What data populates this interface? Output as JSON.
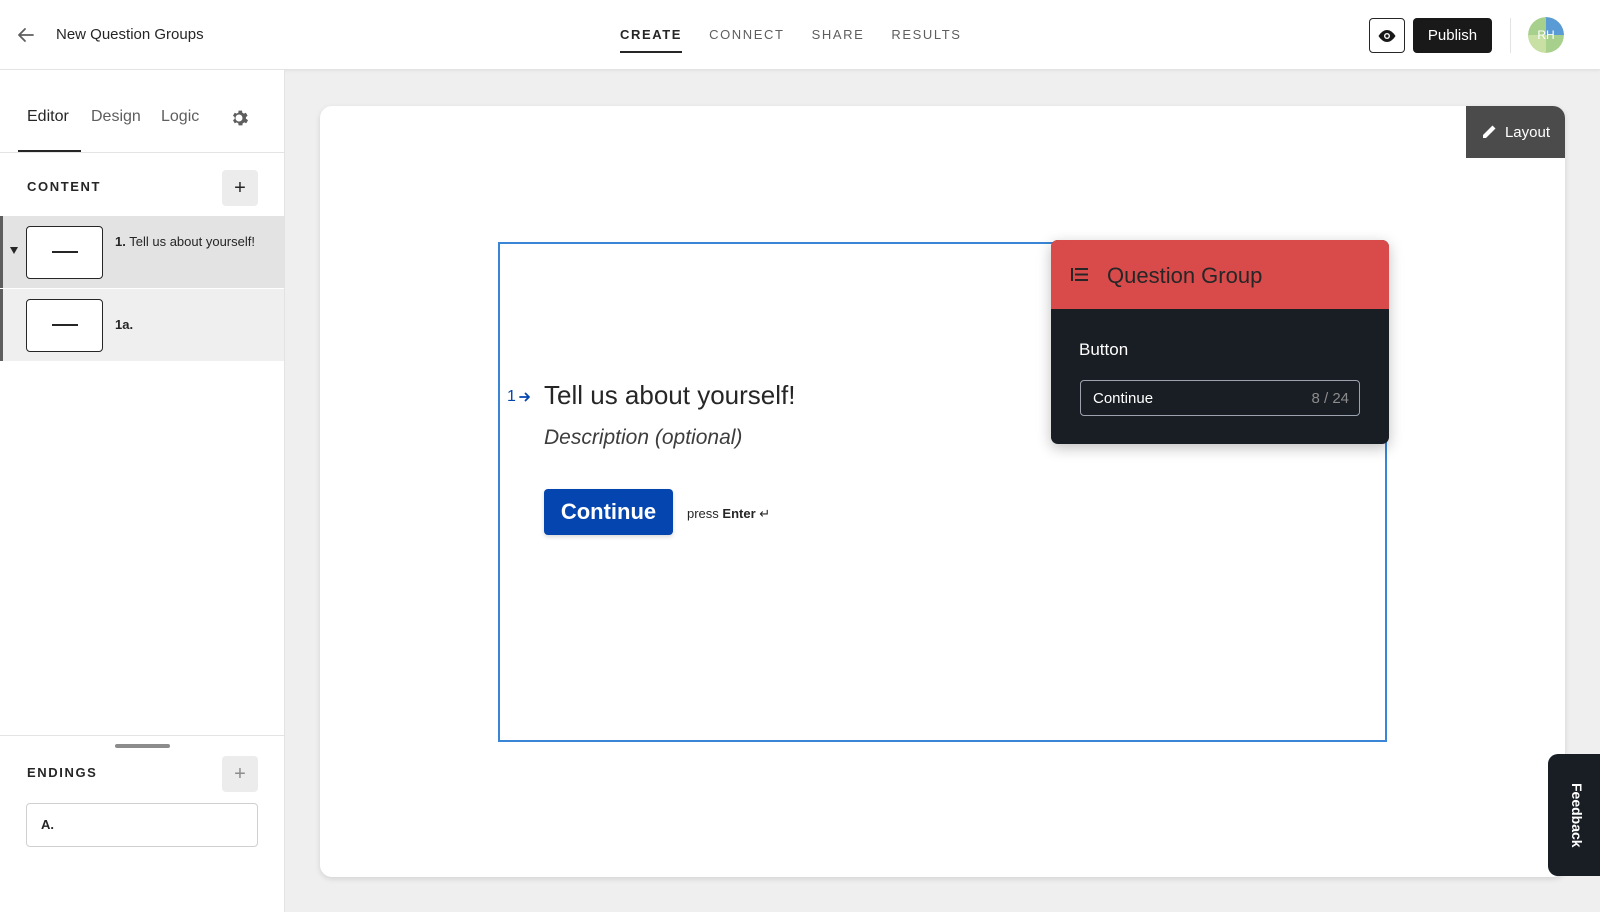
{
  "header": {
    "title": "New Question Groups",
    "tabs": [
      {
        "label": "CREATE",
        "active": true
      },
      {
        "label": "CONNECT",
        "active": false
      },
      {
        "label": "SHARE",
        "active": false
      },
      {
        "label": "RESULTS",
        "active": false
      }
    ],
    "publish_label": "Publish",
    "avatar_initials": "RH"
  },
  "sidebar": {
    "tabs": [
      {
        "label": "Editor",
        "active": true
      },
      {
        "label": "Design",
        "active": false
      },
      {
        "label": "Logic",
        "active": false
      }
    ],
    "content_label": "CONTENT",
    "content_items": [
      {
        "number": "1.",
        "text": "Tell us about yourself!",
        "selected": true
      },
      {
        "number": "1a.",
        "text": "",
        "selected": false
      }
    ],
    "endings_label": "ENDINGS",
    "endings": [
      {
        "label": "A."
      }
    ]
  },
  "canvas": {
    "layout_label": "Layout",
    "question": {
      "number": "1",
      "title": "Tell us about yourself!",
      "description_placeholder": "Description (optional)",
      "button_label": "Continue",
      "press_hint": "press",
      "press_key": "Enter"
    }
  },
  "popover": {
    "title": "Question Group",
    "field_label": "Button",
    "input_value": "Continue",
    "char_count": "8 / 24",
    "header_color": "#d94b4b"
  },
  "feedback_label": "Feedback",
  "colors": {
    "accent": "#0445af",
    "selection_border": "#3a85d6",
    "dark": "#191d24"
  }
}
